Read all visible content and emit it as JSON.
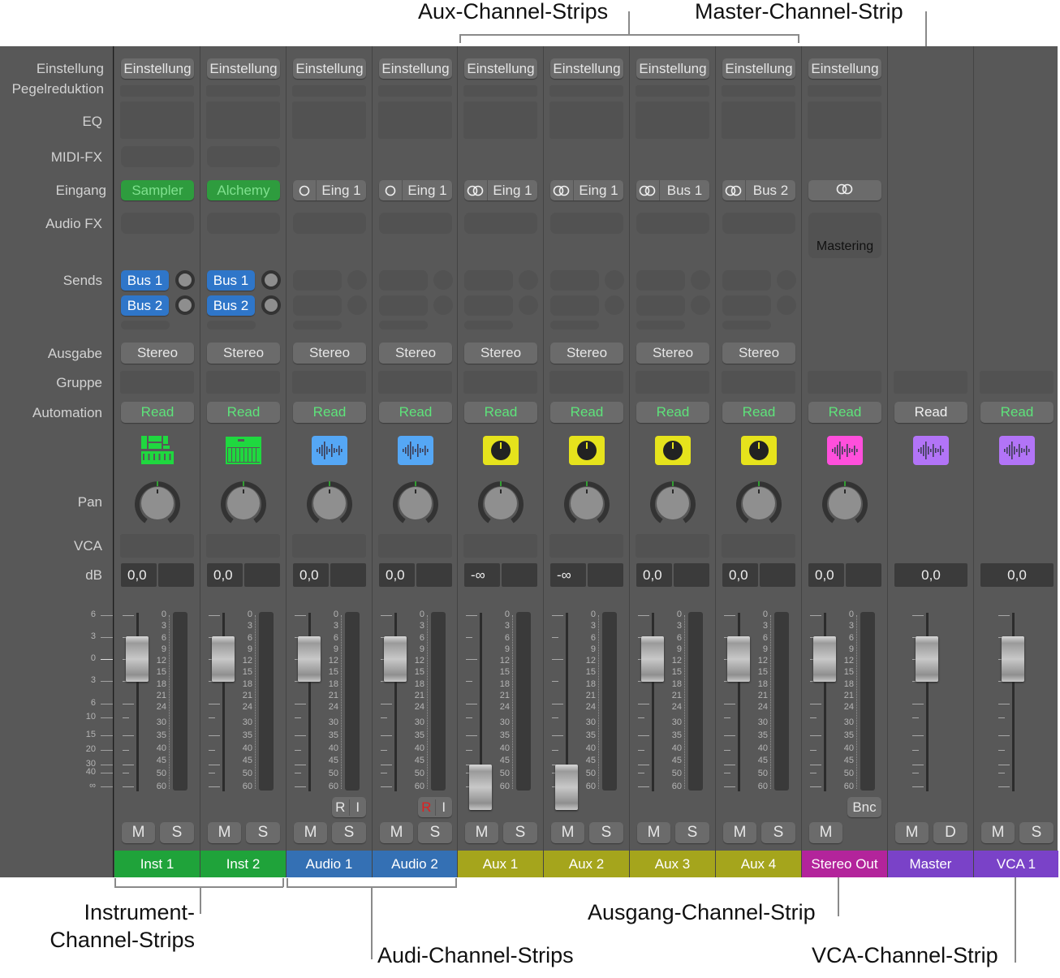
{
  "annotations": {
    "aux": "Aux-Channel-Strips",
    "master": "Master-Channel-Strip",
    "instrument_line1": "Instrument-",
    "instrument_line2": "Channel-Strips",
    "audio": "Audi-Channel-Strips",
    "output": "Ausgang-Channel-Strip",
    "vca": "VCA-Channel-Strip"
  },
  "row_labels": {
    "setting": "Einstellung",
    "gain_reduction": "Pegelreduktion",
    "eq": "EQ",
    "midi_fx": "MIDI-FX",
    "input": "Eingang",
    "audio_fx": "Audio FX",
    "sends": "Sends",
    "output": "Ausgabe",
    "group": "Gruppe",
    "automation": "Automation",
    "pan": "Pan",
    "vca": "VCA",
    "db": "dB"
  },
  "fader_scale_left": [
    "6",
    "3",
    "0",
    "3",
    "6",
    "10",
    "15",
    "20",
    "30",
    "40",
    "∞"
  ],
  "meter_scale": [
    "0",
    "3",
    "6",
    "9",
    "12",
    "15",
    "18",
    "21",
    "24",
    "30",
    "35",
    "40",
    "45",
    "50",
    "60"
  ],
  "strips": [
    {
      "name": "Inst 1",
      "color": "#1fa33a",
      "setting": "Einstellung",
      "input": {
        "kind": "instrument",
        "label": "Sampler"
      },
      "sends": [
        "Bus 1",
        "Bus 2"
      ],
      "output": "Stereo",
      "automation": "Read",
      "automation_color": "#5ee37a",
      "icon": "instrument-rack-icon",
      "icon_color": "#1fd83f",
      "pan": true,
      "db": "0,0",
      "fader_db": 0,
      "buttons": [
        "M",
        "S"
      ],
      "extra": []
    },
    {
      "name": "Inst 2",
      "color": "#1fa33a",
      "setting": "Einstellung",
      "input": {
        "kind": "instrument",
        "label": "Alchemy"
      },
      "sends": [
        "Bus 1",
        "Bus 2"
      ],
      "output": "Stereo",
      "automation": "Read",
      "automation_color": "#5ee37a",
      "icon": "synth-keyboard-icon",
      "icon_color": "#1fd83f",
      "pan": true,
      "db": "0,0",
      "fader_db": 0,
      "buttons": [
        "M",
        "S"
      ],
      "extra": []
    },
    {
      "name": "Audio 1",
      "color": "#3470b4",
      "setting": "Einstellung",
      "input": {
        "kind": "mono",
        "label": "Eing 1"
      },
      "sends": [],
      "output": "Stereo",
      "automation": "Read",
      "automation_color": "#5ee37a",
      "icon": "waveform-icon",
      "icon_color": "#55a7f5",
      "pan": true,
      "db": "0,0",
      "fader_db": 0,
      "buttons": [
        "M",
        "S"
      ],
      "extra": [
        "R",
        "I"
      ],
      "extra_active": false
    },
    {
      "name": "Audio 2",
      "color": "#3470b4",
      "setting": "Einstellung",
      "input": {
        "kind": "mono",
        "label": "Eing 1"
      },
      "sends": [],
      "output": "Stereo",
      "automation": "Read",
      "automation_color": "#5ee37a",
      "icon": "waveform-icon",
      "icon_color": "#55a7f5",
      "pan": true,
      "db": "0,0",
      "fader_db": 0,
      "buttons": [
        "M",
        "S"
      ],
      "extra": [
        "R",
        "I"
      ],
      "extra_active": true
    },
    {
      "name": "Aux 1",
      "color": "#a5a51c",
      "setting": "Einstellung",
      "input": {
        "kind": "stereo",
        "label": "Eing 1"
      },
      "sends": [],
      "output": "Stereo",
      "automation": "Read",
      "automation_color": "#5ee37a",
      "icon": "aux-knob-icon",
      "icon_color": "#e6e31c",
      "pan": true,
      "db": "-∞",
      "fader_db": "-inf",
      "buttons": [
        "M",
        "S"
      ],
      "extra": []
    },
    {
      "name": "Aux 2",
      "color": "#a5a51c",
      "setting": "Einstellung",
      "input": {
        "kind": "stereo",
        "label": "Eing 1"
      },
      "sends": [],
      "output": "Stereo",
      "automation": "Read",
      "automation_color": "#5ee37a",
      "icon": "aux-knob-icon",
      "icon_color": "#e6e31c",
      "pan": true,
      "db": "-∞",
      "fader_db": "-inf",
      "buttons": [
        "M",
        "S"
      ],
      "extra": []
    },
    {
      "name": "Aux 3",
      "color": "#a5a51c",
      "setting": "Einstellung",
      "input": {
        "kind": "stereo",
        "label": "Bus 1"
      },
      "sends": [],
      "output": "Stereo",
      "automation": "Read",
      "automation_color": "#5ee37a",
      "icon": "aux-knob-icon",
      "icon_color": "#e6e31c",
      "pan": true,
      "db": "0,0",
      "fader_db": 0,
      "buttons": [
        "M",
        "S"
      ],
      "extra": []
    },
    {
      "name": "Aux 4",
      "color": "#a5a51c",
      "setting": "Einstellung",
      "input": {
        "kind": "stereo",
        "label": "Bus 2"
      },
      "sends": [],
      "output": "Stereo",
      "automation": "Read",
      "automation_color": "#5ee37a",
      "icon": "aux-knob-icon",
      "icon_color": "#e6e31c",
      "pan": true,
      "db": "0,0",
      "fader_db": 0,
      "buttons": [
        "M",
        "S"
      ],
      "extra": []
    },
    {
      "name": "Stereo Out",
      "color": "#b3249b",
      "setting": "Einstellung",
      "input": {
        "kind": "stereo",
        "label": ""
      },
      "audio_fx": "Mastering",
      "sends": [],
      "output": "",
      "automation": "Read",
      "automation_color": "#5ee37a",
      "icon": "waveform-icon",
      "icon_color": "#ff4fdc",
      "pan": true,
      "db": "0,0",
      "fader_db": 0,
      "buttons": [
        "M"
      ],
      "extra": [
        "Bnc"
      ]
    },
    {
      "name": "Master",
      "color": "#7a42c8",
      "setting": "",
      "input": null,
      "sends": [],
      "output": "",
      "automation": "Read",
      "automation_color": "#f0f0f0",
      "icon": "waveform-icon",
      "icon_color": "#b274f7",
      "pan": false,
      "db": "0,0",
      "fader_db": 0,
      "buttons": [
        "M",
        "D"
      ],
      "extra": []
    },
    {
      "name": "VCA 1",
      "color": "#7a42c8",
      "setting": "",
      "input": null,
      "sends": [],
      "output": "",
      "automation": "Read",
      "automation_color": "#5ee37a",
      "icon": "waveform-icon",
      "icon_color": "#b274f7",
      "pan": false,
      "db": "0,0",
      "fader_db": 0,
      "buttons": [
        "M",
        "S"
      ],
      "extra": []
    }
  ]
}
